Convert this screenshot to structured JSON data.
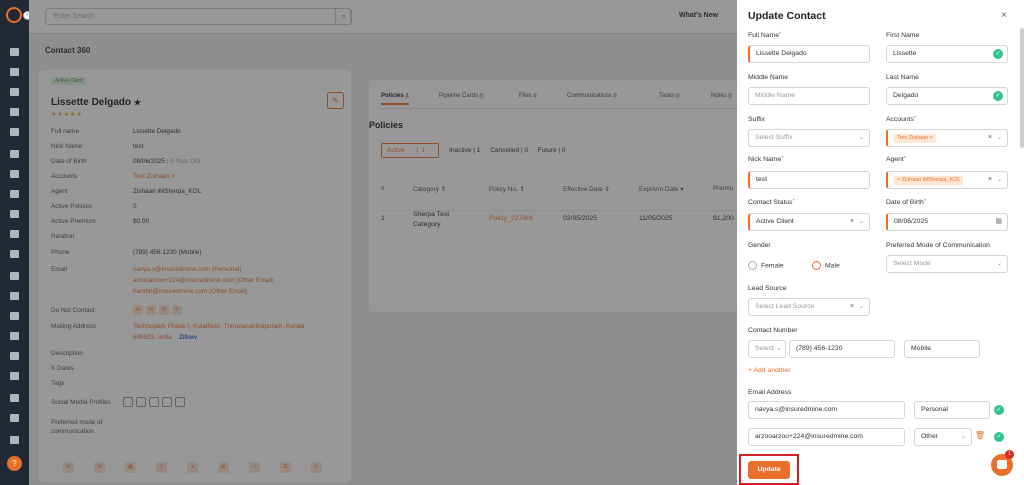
{
  "colors": {
    "accent": "#e8702a",
    "success": "#34c38f",
    "highlight": "#d42020",
    "nav_bg": "#1f2a35"
  },
  "nav": {
    "collapse_glyph": "‹",
    "avatar_glyph": "?"
  },
  "topbar": {
    "search_placeholder": "Enter Search",
    "search_glyph": "⌕",
    "whats_new": "What's New"
  },
  "breadcrumb": "Contact 360",
  "contact_card": {
    "badge": "Active Client",
    "name": "Lissette Delgado",
    "stars": "★★★★★",
    "edit_glyph": "✎",
    "fields": {
      "full_name": {
        "label": "Full name",
        "value": "Lissette Delgado"
      },
      "nick_name": {
        "label": "Nick Name",
        "value": "test"
      },
      "dob": {
        "label": "Date of Birth",
        "value": "08/06/2025",
        "extra": "| 0 Year Old"
      },
      "accounts": {
        "label": "Accounts",
        "value": "Test Zishaan >"
      },
      "agent": {
        "label": "Agent",
        "value": "Zishaan iMSherpa_KOL"
      },
      "active_policies": {
        "label": "Active Policies",
        "value": "0"
      },
      "active_premium": {
        "label": "Active Premium",
        "value": "$0.00"
      },
      "relation": {
        "label": "Relation",
        "value": ""
      },
      "phone": {
        "label": "Phone",
        "value": "(789) 456-1230 (Mobile)"
      },
      "email": {
        "label": "Email",
        "values": [
          "navya.s@insuredmine.com  (Personal)",
          "arzooarzoo+224@insuredmine.com  (Other Email)",
          "harshit@insuredmine.com  (Other Email)"
        ]
      },
      "do_not_contact": {
        "label": "Do Not Contact"
      },
      "mailing_address": {
        "label": "Mailing Address",
        "line1": "Technopark Phase I, Kulathoor, Thiruvananthapuram, Kerala",
        "line2": "695583, India",
        "zillow": "Zillow"
      },
      "description": {
        "label": "Description"
      },
      "x_dates": {
        "label": "X Dates"
      },
      "tags": {
        "label": "Tags"
      },
      "social": {
        "label": "Social Media Profiles"
      },
      "preferred_mode": {
        "label_1": "Preferred mode of",
        "label_2": "communication"
      }
    }
  },
  "policies_panel": {
    "tabs": [
      {
        "label": "Policies",
        "count": "1"
      },
      {
        "label": "Pipeline Cards",
        "count": "0"
      },
      {
        "label": "Files",
        "count": "0"
      },
      {
        "label": "Communications",
        "count": "0"
      },
      {
        "label": "Tasks",
        "count": "0"
      },
      {
        "label": "Notes",
        "count": "0"
      }
    ],
    "title": "Policies",
    "filters": {
      "active": "Active",
      "active_count": "1",
      "inactive": "Inactive | 1",
      "cancelled": "Cancelled | 0",
      "future": "Future | 0"
    },
    "columns": [
      "#",
      "Category ⇕",
      "Policy No. ⇕",
      "Effective Date ⇕",
      "Exp/Ann Date ▾",
      "Premiu"
    ],
    "rows": [
      {
        "num": "1",
        "category_1": "Sherpa Test",
        "category_2": "Category",
        "policy": "Policy_2278HI",
        "effective": "02/05/2025",
        "expiry": "11/05/2025",
        "premium": "$1,200."
      }
    ]
  },
  "modal": {
    "title": "Update Contact",
    "close_glyph": "×",
    "full_name": {
      "label": "Full Name",
      "value": "Lissette Delgado"
    },
    "first_name": {
      "label": "First Name",
      "value": "Lissette"
    },
    "middle_name": {
      "label": "Middle Name",
      "placeholder": "Middle Name"
    },
    "last_name": {
      "label": "Last Name",
      "value": "Delgado"
    },
    "suffix": {
      "label": "Suffix",
      "placeholder": "Select Suffix"
    },
    "accounts": {
      "label": "Accounts",
      "tag": "Test Zishaan"
    },
    "nick_name": {
      "label": "Nick Name",
      "value": "test"
    },
    "agent": {
      "label": "Agent",
      "tag": "Zishaan iMSherpa_KOL"
    },
    "contact_status": {
      "label": "Contact Status",
      "value": "Active Client"
    },
    "dob": {
      "label": "Date of Birth",
      "value": "08/06/2025"
    },
    "gender": {
      "label": "Gender",
      "options": [
        "Female",
        "Male"
      ],
      "selected": "Male"
    },
    "preferred_mode": {
      "label": "Preferred Mode of Communication",
      "placeholder": "Select Mode"
    },
    "lead_source": {
      "label": "Lead Source",
      "placeholder": "Select Lead Source"
    },
    "contact_number": {
      "label": "Contact Number",
      "country": "Select",
      "number": "(789) 456-1230",
      "type": "Mobile"
    },
    "add_another": "+ Add another",
    "email": {
      "label": "Email Address",
      "rows": [
        {
          "address": "navya.s@insuredmine.com",
          "type": "Personal"
        },
        {
          "address": "arzooarzoo+224@insuredmine.com",
          "type": "Other"
        }
      ]
    },
    "update_button": "Update",
    "chat_count": "1"
  }
}
